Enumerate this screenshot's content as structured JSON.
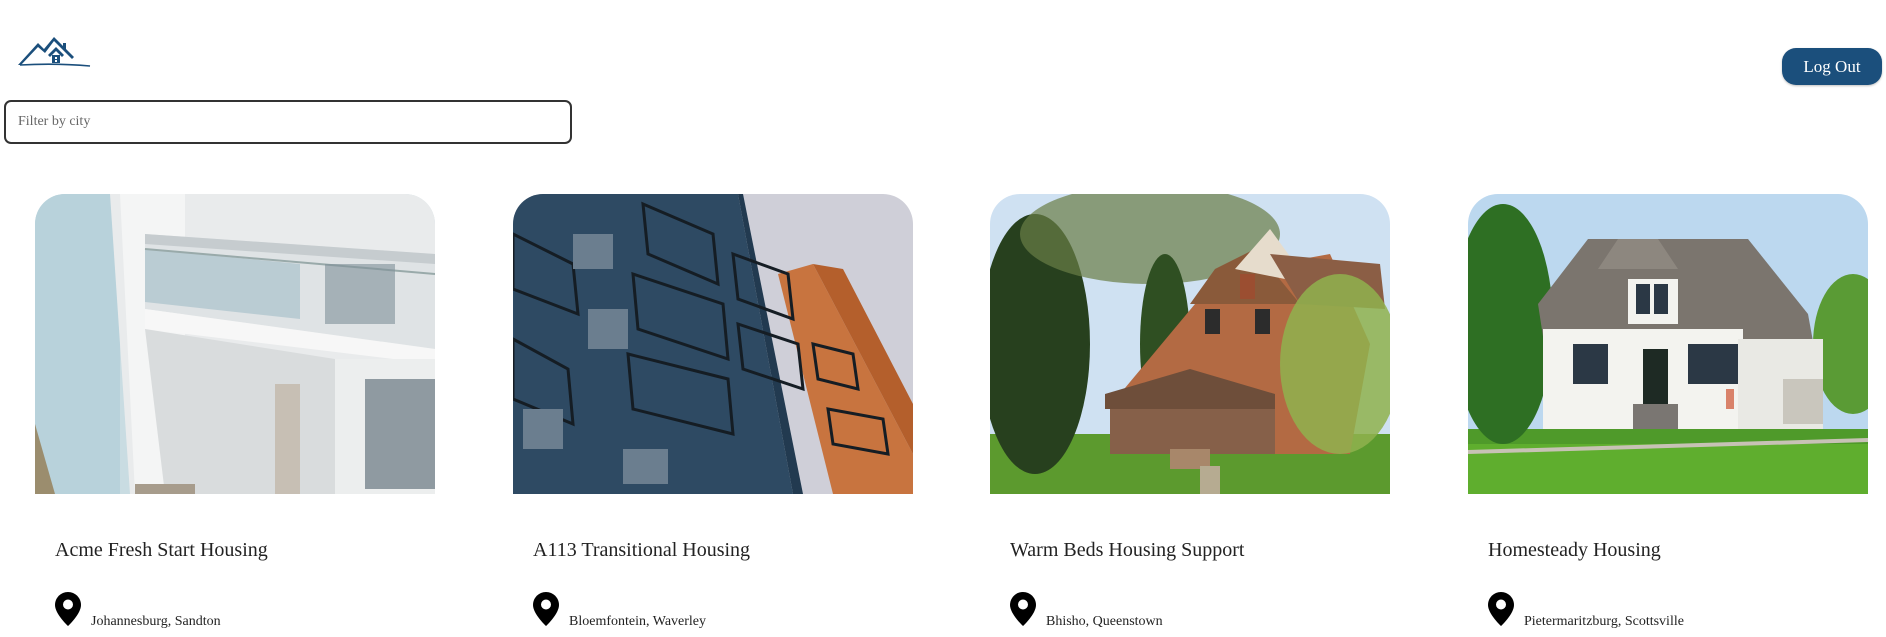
{
  "header": {
    "logo_icon": "house-roofs-logo-icon",
    "logout_label": "Log Out"
  },
  "filter": {
    "placeholder": "Filter by city",
    "value": ""
  },
  "colors": {
    "accent": "#1b4f7c",
    "text": "#222222",
    "background": "#ffffff"
  },
  "listings": [
    {
      "title": "Acme Fresh Start Housing",
      "location": "Johannesburg, Sandton",
      "image": "white-modern-apartment-balconies"
    },
    {
      "title": "A113 Transitional Housing",
      "location": "Bloemfontein, Waverley",
      "image": "blue-and-orange-apartment-block"
    },
    {
      "title": "Warm Beds Housing Support",
      "location": "Bhisho, Queenstown",
      "image": "brick-victorian-house-with-trees"
    },
    {
      "title": "Homesteady Housing",
      "location": "Pietermaritzburg, Scottsville",
      "image": "white-cottage-with-lawn"
    }
  ]
}
